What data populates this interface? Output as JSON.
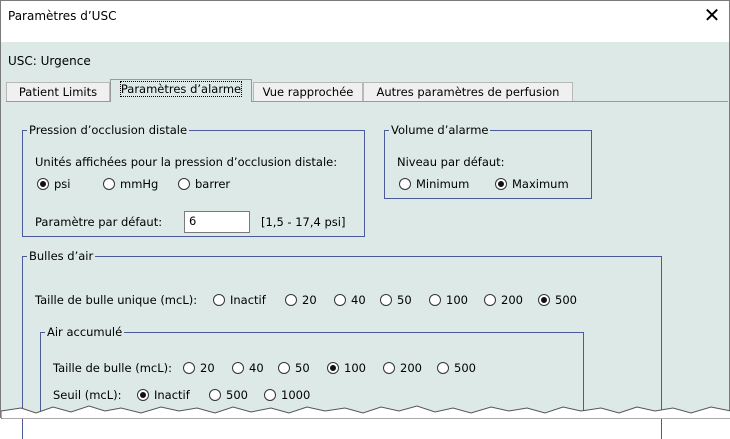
{
  "window": {
    "title": "Paramètres d’USC"
  },
  "usc_label": "USC: Urgence",
  "tabs": [
    {
      "label": "Patient Limits",
      "active": false
    },
    {
      "label": "Paramètres d’alarme",
      "active": true
    },
    {
      "label": "Vue rapprochée",
      "active": false
    },
    {
      "label": "Autres paramètres de perfusion",
      "active": false
    }
  ],
  "occlusion": {
    "legend": "Pression d’occlusion distale",
    "units_label": "Unités affichées pour la pression d’occlusion distale:",
    "units": [
      "psi",
      "mmHg",
      "barrer"
    ],
    "selected_unit": "psi",
    "default_label": "Paramètre par défaut:",
    "default_value": "6",
    "range": "[1,5 - 17,4 psi]"
  },
  "alarm_volume": {
    "legend": "Volume d’alarme",
    "level_label": "Niveau par défaut:",
    "options": [
      "Minimum",
      "Maximum"
    ],
    "selected": "Maximum"
  },
  "air_bubbles": {
    "legend": "Bulles d’air",
    "single_label": "Taille de bulle unique (mcL):",
    "single_options": [
      "Inactif",
      "20",
      "40",
      "50",
      "100",
      "200",
      "500"
    ],
    "single_selected": "500",
    "accumulated": {
      "legend": "Air accumulé",
      "size_label": "Taille de bulle (mcL):",
      "size_options": [
        "20",
        "40",
        "50",
        "100",
        "200",
        "500"
      ],
      "size_selected": "100",
      "threshold_label": "Seuil (mcL):",
      "threshold_options": [
        "Inactif",
        "500",
        "1000"
      ],
      "threshold_selected": "Inactif"
    }
  },
  "colors": {
    "client_bg": "#dce9e7",
    "groupbox_border": "#4b5a9b"
  }
}
